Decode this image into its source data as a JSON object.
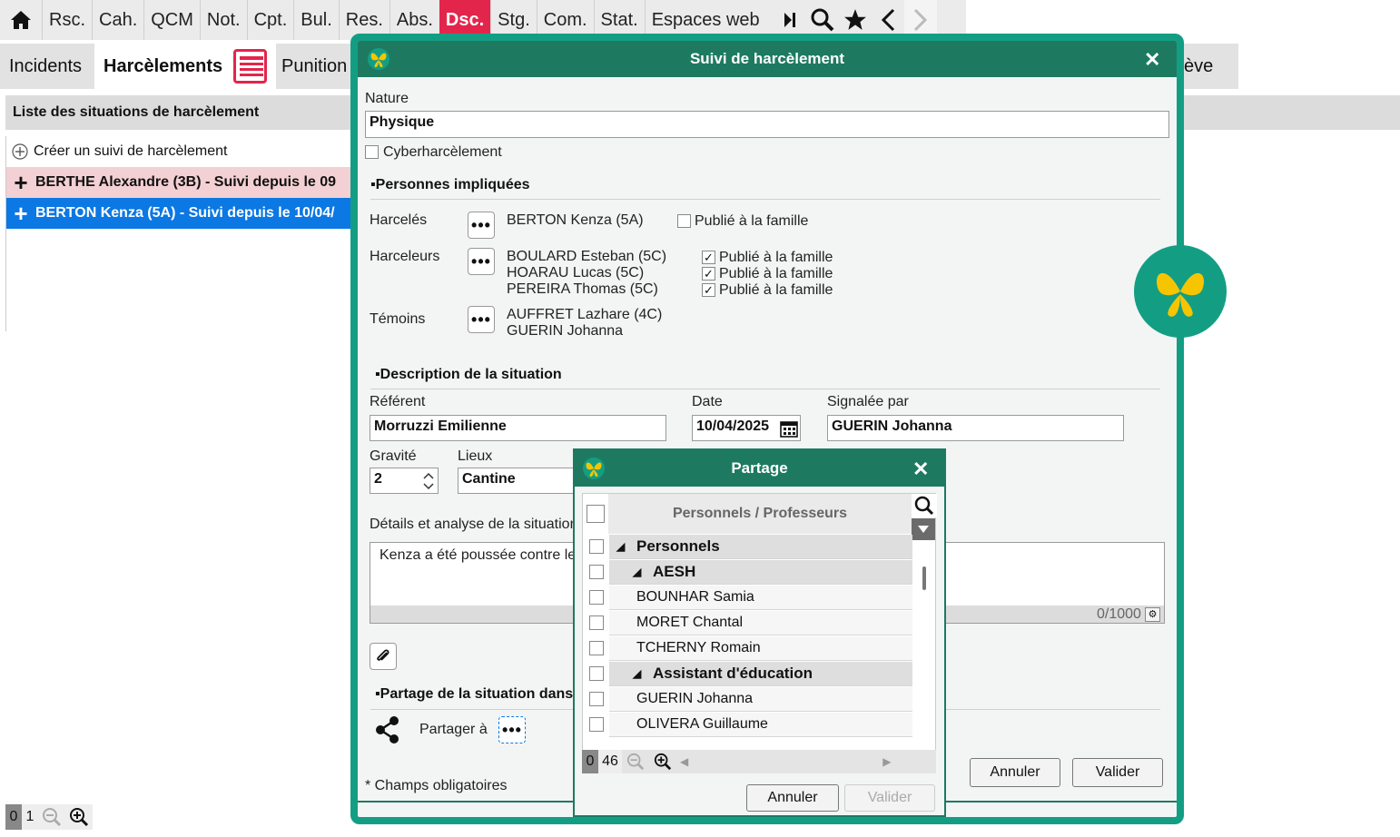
{
  "topnav": {
    "items": [
      "Rsc.",
      "Cah.",
      "QCM",
      "Not.",
      "Cpt.",
      "Bul.",
      "Res.",
      "Abs.",
      "Dsc.",
      "Stg.",
      "Com.",
      "Stat.",
      "Espaces web"
    ],
    "active": "Dsc."
  },
  "tabs": {
    "incidents": "Incidents",
    "harcelements": "Harcèlements",
    "punitions": "Punition",
    "eleve": "ève"
  },
  "list": {
    "header": "Liste des situations de harcèlement",
    "create": "Créer un suivi de harcèlement",
    "rows": [
      "BERTHE Alexandre (3B) - Suivi depuis le 09",
      "BERTON Kenza (5A) - Suivi depuis le 10/04/"
    ]
  },
  "zoom_left": {
    "a": "0",
    "b": "1"
  },
  "dialog": {
    "title": "Suivi de harcèlement",
    "nature_label": "Nature",
    "nature_value": "Physique",
    "cyber_label": "Cyberharcèlement",
    "persons_section": "Personnes impliquées",
    "harceles_label": "Harcelés",
    "harceles": [
      "BERTON Kenza (5A)"
    ],
    "harceleurs_label": "Harceleurs",
    "harceleurs": [
      "BOULARD Esteban (5C)",
      "HOARAU Lucas (5C)",
      "PEREIRA Thomas (5C)"
    ],
    "temoins_label": "Témoins",
    "temoins": [
      "AUFFRET Lazhare (4C)",
      "GUERIN Johanna"
    ],
    "publie": "Publié à la famille",
    "dots": "•••",
    "desc_section": "Description de la situation",
    "referent_label": "Référent",
    "referent_value": "Morruzzi Emilienne",
    "date_label": "Date",
    "date_value": "10/04/2025",
    "signalee_label": "Signalée par",
    "signalee_value": "GUERIN Johanna",
    "gravite_label": "Gravité",
    "gravite_value": "2",
    "lieux_label": "Lieux",
    "lieux_value": "Cantine",
    "details_label": "Détails et analyse de la situation",
    "details_value": "Kenza a été poussée contre le",
    "counter": "0/1000",
    "partage_section": "Partage de la situation dans",
    "partager_label": "Partager à",
    "required": "* Champs obligatoires",
    "cancel": "Annuler",
    "validate": "Valider"
  },
  "partage": {
    "title": "Partage",
    "column_header": "Personnels / Professeurs",
    "rows": [
      {
        "label": "Personnels",
        "group": true
      },
      {
        "label": "AESH",
        "group": true
      },
      {
        "label": "BOUNHAR Samia",
        "group": false
      },
      {
        "label": "MORET Chantal",
        "group": false
      },
      {
        "label": "TCHERNY Romain",
        "group": false
      },
      {
        "label": "Assistant d'éducation",
        "group": true
      },
      {
        "label": "GUERIN Johanna",
        "group": false
      },
      {
        "label": "OLIVERA Guillaume",
        "group": false
      }
    ],
    "count_a": "0",
    "count_b": "46",
    "cancel": "Annuler",
    "validate": "Valider"
  },
  "colors": {
    "accent_red": "#e4254b",
    "dialog_green": "#1d7a61",
    "border_green": "#139e84",
    "selected_blue": "#0b78e3",
    "pink_row": "#f3d0d3",
    "logo_yellow": "#f6c500"
  }
}
